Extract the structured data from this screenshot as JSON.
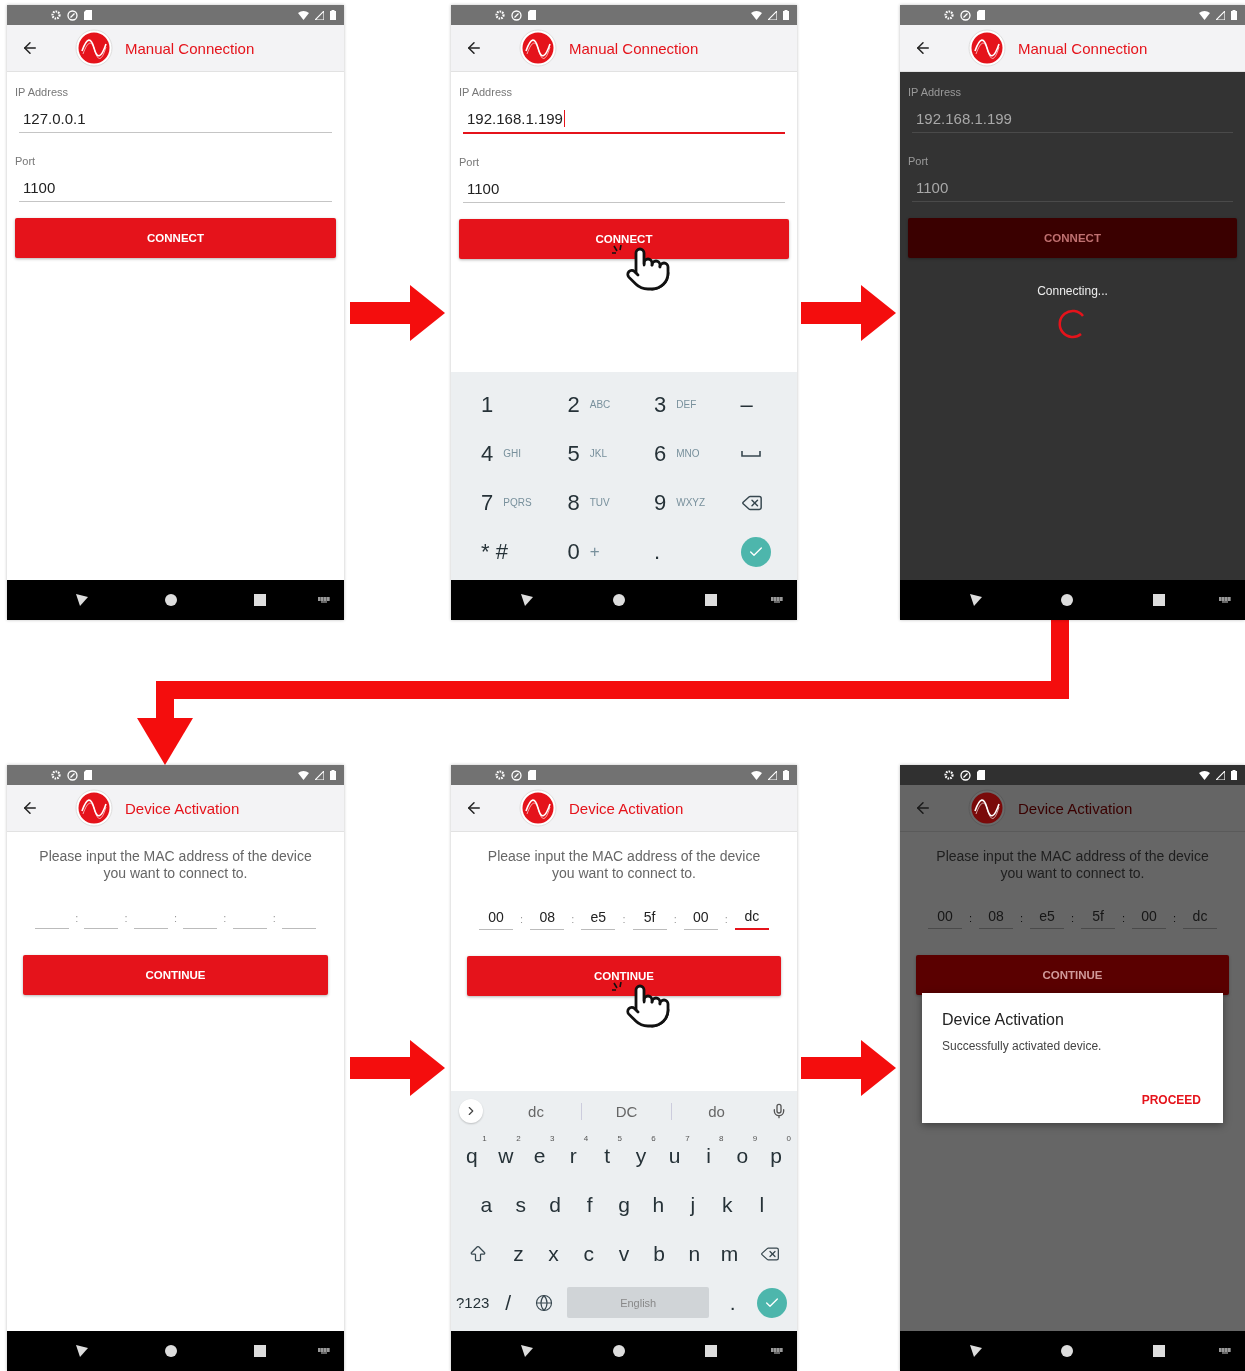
{
  "screens": [
    {
      "kind": "connection",
      "content_dimmed": false,
      "header": {
        "title": "Manual Connection",
        "dimmed": false
      },
      "fields": [
        {
          "label": "IP Address",
          "value": "127.0.0.1",
          "focused": false
        },
        {
          "label": "Port",
          "value": "1100",
          "focused": false
        }
      ],
      "button": {
        "label": "CONNECT",
        "tapped": false
      }
    },
    {
      "kind": "connection",
      "content_dimmed": false,
      "header": {
        "title": "Manual Connection",
        "dimmed": false
      },
      "fields": [
        {
          "label": "IP Address",
          "value": "192.168.1.199",
          "focused": true
        },
        {
          "label": "Port",
          "value": "1100",
          "focused": false
        }
      ],
      "button": {
        "label": "CONNECT",
        "tapped": true
      },
      "keyboard": {
        "kind": "numeric",
        "rows": [
          {
            "keys": [
              {
                "kind": "char",
                "main": "1"
              },
              {
                "kind": "char",
                "main": "2",
                "sub": "ABC"
              },
              {
                "kind": "char",
                "main": "3",
                "sub": "DEF"
              },
              {
                "kind": "char",
                "main": "–"
              }
            ]
          },
          {
            "keys": [
              {
                "kind": "char",
                "main": "4",
                "sub": "GHI"
              },
              {
                "kind": "char",
                "main": "5",
                "sub": "JKL"
              },
              {
                "kind": "char",
                "main": "6",
                "sub": "MNO"
              },
              {
                "kind": "space"
              }
            ]
          },
          {
            "keys": [
              {
                "kind": "char",
                "main": "7",
                "sub": "PQRS"
              },
              {
                "kind": "char",
                "main": "8",
                "sub": "TUV"
              },
              {
                "kind": "char",
                "main": "9",
                "sub": "WXYZ"
              },
              {
                "kind": "backspace"
              }
            ]
          },
          {
            "keys": [
              {
                "kind": "char",
                "main": "* #"
              },
              {
                "kind": "char",
                "main": "0",
                "sub": "+"
              },
              {
                "kind": "char",
                "main": "."
              },
              {
                "kind": "enter"
              }
            ]
          }
        ]
      }
    },
    {
      "kind": "connection",
      "content_dimmed": true,
      "header": {
        "title": "Manual Connection",
        "dimmed": false
      },
      "fields": [
        {
          "label": "IP Address",
          "value": "192.168.1.199",
          "focused": false
        },
        {
          "label": "Port",
          "value": "1100",
          "focused": false
        }
      ],
      "button": {
        "label": "CONNECT",
        "tapped": false
      },
      "progress": {
        "text": "Connecting..."
      }
    },
    {
      "kind": "activation",
      "content_dimmed": false,
      "header": {
        "title": "Device Activation",
        "dimmed": false
      },
      "instructions": "Please input the MAC address of the device you want to connect to.",
      "separators": [
        ":",
        ":",
        ":",
        ":",
        ":"
      ],
      "mac": [
        {
          "focused": false
        },
        {
          "focused": false
        },
        {
          "focused": false
        },
        {
          "focused": false
        },
        {
          "focused": false
        },
        {
          "focused": false
        }
      ],
      "button": {
        "label": "CONTINUE",
        "tapped": false
      }
    },
    {
      "kind": "activation",
      "content_dimmed": false,
      "header": {
        "title": "Device Activation",
        "dimmed": false
      },
      "instructions": "Please input the MAC address of the device you want to connect to.",
      "separators": [
        ":",
        ":",
        ":",
        ":",
        ":"
      ],
      "mac": [
        {
          "value": "00",
          "focused": false
        },
        {
          "value": "08",
          "focused": false
        },
        {
          "value": "e5",
          "focused": false
        },
        {
          "value": "5f",
          "focused": false
        },
        {
          "value": "00",
          "focused": false
        },
        {
          "value": "dc",
          "focused": true
        }
      ],
      "button": {
        "label": "CONTINUE",
        "tapped": true
      },
      "keyboard": {
        "kind": "qwerty",
        "suggestions": [
          "dc",
          "DC",
          "do"
        ],
        "rows": [
          {
            "keys": [
              {
                "kind": "char",
                "main": "q",
                "sub": "1"
              },
              {
                "kind": "char",
                "main": "w",
                "sub": "2"
              },
              {
                "kind": "char",
                "main": "e",
                "sub": "3"
              },
              {
                "kind": "char",
                "main": "r",
                "sub": "4"
              },
              {
                "kind": "char",
                "main": "t",
                "sub": "5"
              },
              {
                "kind": "char",
                "main": "y",
                "sub": "6"
              },
              {
                "kind": "char",
                "main": "u",
                "sub": "7"
              },
              {
                "kind": "char",
                "main": "i",
                "sub": "8"
              },
              {
                "kind": "char",
                "main": "o",
                "sub": "9"
              },
              {
                "kind": "char",
                "main": "p",
                "sub": "0"
              }
            ]
          },
          {
            "keys": [
              {
                "kind": "char",
                "main": "a"
              },
              {
                "kind": "char",
                "main": "s"
              },
              {
                "kind": "char",
                "main": "d"
              },
              {
                "kind": "char",
                "main": "f"
              },
              {
                "kind": "char",
                "main": "g"
              },
              {
                "kind": "char",
                "main": "h"
              },
              {
                "kind": "char",
                "main": "j"
              },
              {
                "kind": "char",
                "main": "k"
              },
              {
                "kind": "char",
                "main": "l"
              }
            ]
          },
          {
            "keys": [
              {
                "kind": "shift"
              },
              {
                "kind": "char",
                "main": "z"
              },
              {
                "kind": "char",
                "main": "x"
              },
              {
                "kind": "char",
                "main": "c"
              },
              {
                "kind": "char",
                "main": "v"
              },
              {
                "kind": "char",
                "main": "b"
              },
              {
                "kind": "char",
                "main": "n"
              },
              {
                "kind": "char",
                "main": "m"
              },
              {
                "kind": "backspace"
              }
            ]
          },
          {
            "keys": [
              {
                "kind": "char",
                "main": "?123"
              },
              {
                "kind": "char",
                "main": "/"
              },
              {
                "kind": "globe"
              },
              {
                "kind": "space",
                "label": "English"
              },
              {
                "kind": "char",
                "main": "."
              },
              {
                "kind": "enter"
              }
            ]
          }
        ]
      }
    },
    {
      "kind": "activation",
      "content_dimmed": true,
      "header": {
        "title": "Device Activation",
        "dimmed": true
      },
      "instructions": "Please input the MAC address of the device you want to connect to.",
      "separators": [
        ":",
        ":",
        ":",
        ":",
        ":"
      ],
      "mac": [
        {
          "value": "00",
          "focused": false
        },
        {
          "value": "08",
          "focused": false
        },
        {
          "value": "e5",
          "focused": false
        },
        {
          "value": "5f",
          "focused": false
        },
        {
          "value": "00",
          "focused": false
        },
        {
          "value": "dc",
          "focused": false
        }
      ],
      "button": {
        "label": "CONTINUE",
        "tapped": false
      },
      "dialog": {
        "title": "Device Activation",
        "message": "Successfully activated device.",
        "action": "PROCEED"
      }
    }
  ]
}
